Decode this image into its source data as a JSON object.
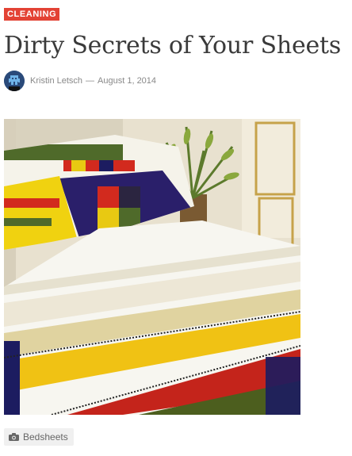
{
  "article": {
    "category": "CLEANING",
    "title": "Dirty Secrets of Your Sheets",
    "author": "Kristin Letsch",
    "separator": "—",
    "date": "August 1, 2014",
    "tag": "Bedsheets"
  },
  "icons": {
    "avatar": "author-avatar-icon",
    "tag": "camera-icon"
  },
  "colors": {
    "badge": "#e34234",
    "title": "#3a3a3a",
    "meta": "#888888"
  }
}
